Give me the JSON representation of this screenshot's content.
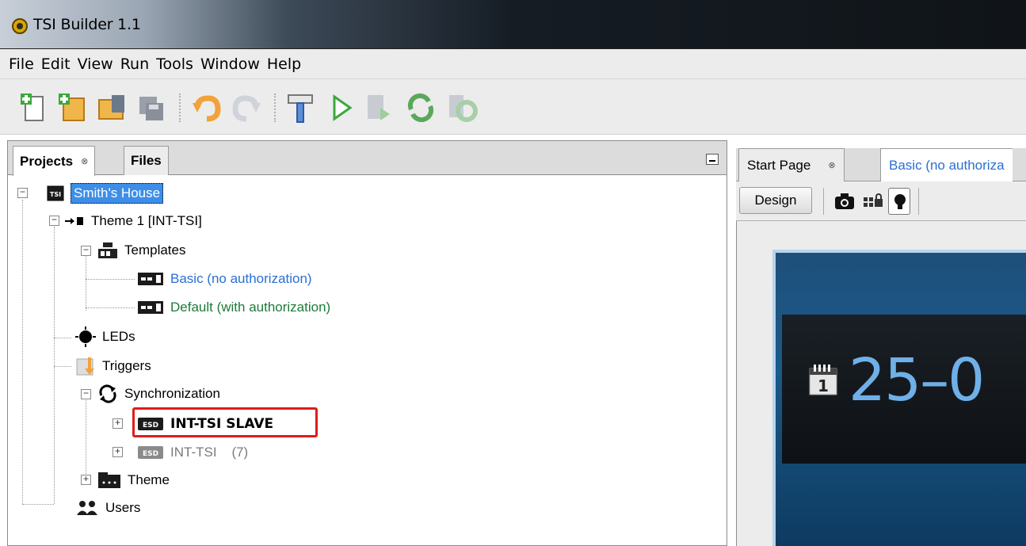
{
  "window": {
    "title": "TSI Builder 1.1"
  },
  "menu": [
    "File",
    "Edit",
    "View",
    "Run",
    "Tools",
    "Window",
    "Help"
  ],
  "toolbar": {
    "icons": [
      "new-file-icon",
      "new-project-icon",
      "open-project-icon",
      "save-all-icon",
      "undo-icon",
      "redo-icon",
      "build-hammer-icon",
      "run-icon",
      "upload-icon",
      "sync-icon",
      "sync-disabled-icon"
    ]
  },
  "left_panel": {
    "tabs": [
      {
        "label": "Projects",
        "close": "⊗"
      },
      {
        "label": "Files"
      }
    ],
    "tree": {
      "root": "Smith's House",
      "theme1": "Theme 1 [INT-TSI]",
      "templates": "Templates",
      "template_items": [
        {
          "label": "Basic (no authorization)",
          "color": "#2a6fd4"
        },
        {
          "label": "Default (with authorization)",
          "color": "#1e7a3a"
        }
      ],
      "leds": "LEDs",
      "triggers": "Triggers",
      "synchronization": "Synchronization",
      "sync_items": [
        {
          "label": "INT-TSI SLAVE",
          "bold": true
        },
        {
          "label": "INT-TSI    (7)",
          "grey": true
        }
      ],
      "theme": "Theme",
      "users": "Users"
    }
  },
  "right_panel": {
    "tabs": [
      {
        "label": "Start Page",
        "close": "⊗"
      },
      {
        "label": "Basic (no authoriza",
        "color": "#2a6fd4"
      }
    ],
    "design_button": "Design",
    "preview": {
      "date_text": "25–0",
      "calendar_day": "1"
    }
  },
  "colors": {
    "selection": "#3d8ee8",
    "highlight_box": "#e01b1b"
  }
}
